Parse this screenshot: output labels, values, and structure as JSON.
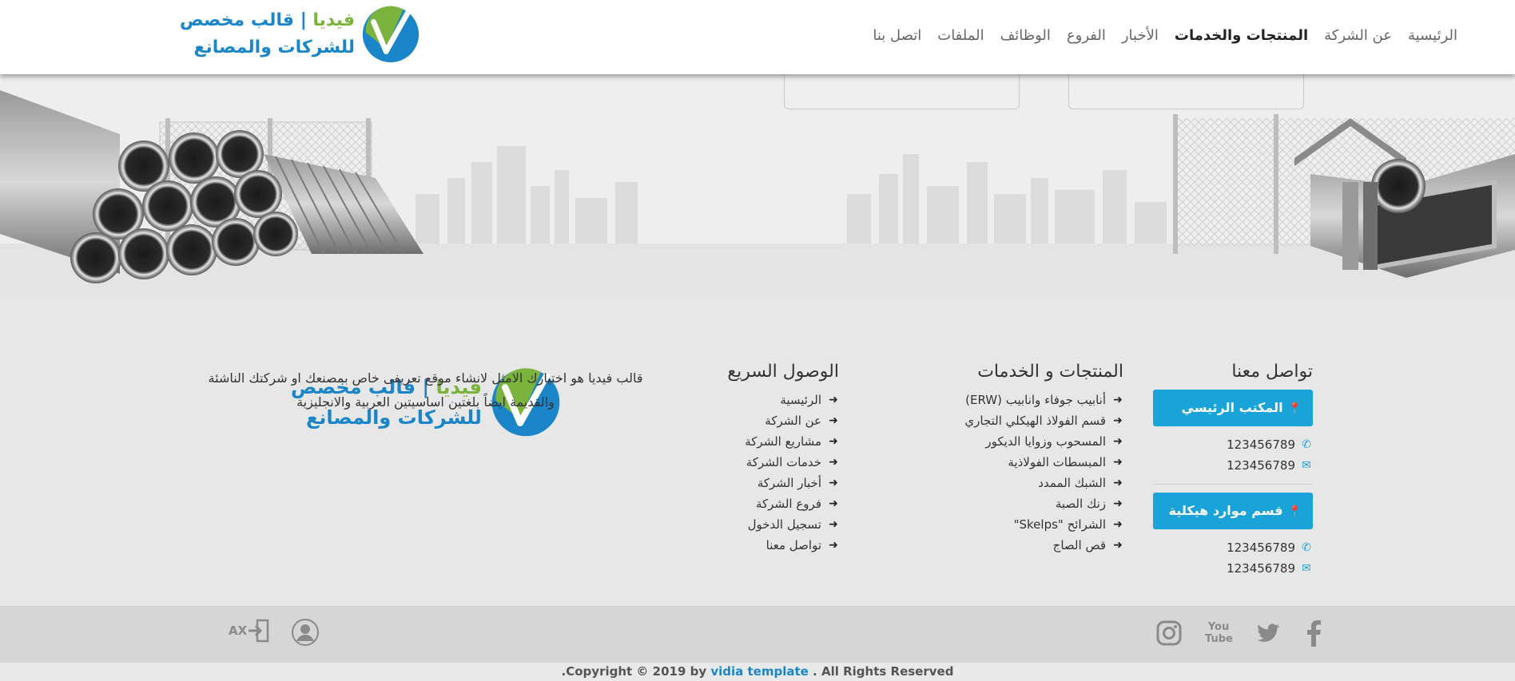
{
  "header": {
    "logo": {
      "line1_green": "فيديا",
      "line1_sep": " | ",
      "line1_rest": "قالب مخصص",
      "line2": "للشركات  والمصانع"
    },
    "nav": [
      {
        "label": "الرئيسية",
        "active": false
      },
      {
        "label": "عن الشركة",
        "active": false
      },
      {
        "label": "المنتجات والخدمات",
        "active": true
      },
      {
        "label": "الأخبار",
        "active": false
      },
      {
        "label": "الفروع",
        "active": false
      },
      {
        "label": "الوظائف",
        "active": false
      },
      {
        "label": "الملفات",
        "active": false
      },
      {
        "label": "اتصل بنا",
        "active": false
      }
    ]
  },
  "contact": {
    "title": "تواصل معنا",
    "offices": [
      {
        "name": "المكتب الرئيسي",
        "phone": "123456789",
        "email": "123456789"
      },
      {
        "name": "قسم موارد هيكلية",
        "phone": "123456789",
        "email": "123456789"
      }
    ]
  },
  "products": {
    "title": "المنتجات و الخدمات",
    "items": [
      "أنابيب جوفاء وانابيب (ERW)",
      "قسم الفولاذ الهيكلي التجاري",
      "المسحوب وزوايا الديكور",
      "المبسطات الفولاذية",
      "الشبك الممدد",
      "زنك الصبة",
      "الشرائح \"Skelps\"",
      "قص الصاج"
    ]
  },
  "quick": {
    "title": "الوصول السريع",
    "items": [
      "الرئيسية",
      "عن الشركة",
      "مشاريع الشركة",
      "خدمات الشركة",
      "أخبار الشركة",
      "فروع الشركة",
      "تسجيل الدخول",
      "تواصل معنا"
    ]
  },
  "about": {
    "text": "قالب فيديا هو اختيارك الامثل لانشاء موقع تعريفى خاص بمصنعك او شركتك الناشئة والقديمة ايضاً بلغتين اساسيتين العربية والانجليزية"
  },
  "bottom": {
    "social": [
      "facebook-icon",
      "twitter-icon",
      "youtube-icon",
      "instagram-icon"
    ],
    "youtube_label": "You Tube",
    "user_icon": "user-icon",
    "login_icon": "login-icon",
    "login_label": "AX"
  },
  "copyright": {
    "prefix": ".Copyright © 2019 by ",
    "brand": "vidia template",
    "suffix": " . All Rights Reserved"
  },
  "colors": {
    "accent": "#1aa3d9",
    "logo_blue": "#1a86c9",
    "logo_green": "#7bb43c"
  }
}
